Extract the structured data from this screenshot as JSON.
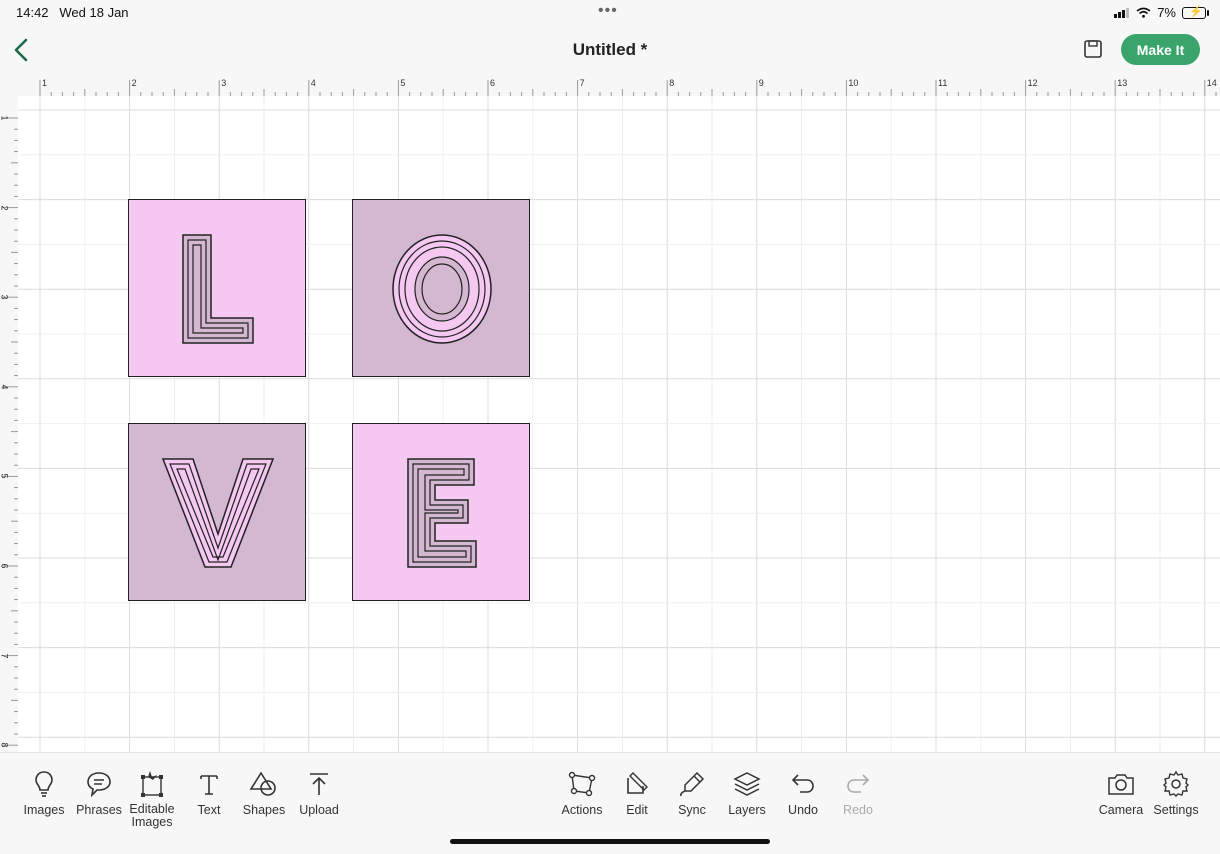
{
  "status": {
    "time": "14:42",
    "date": "Wed 18 Jan",
    "battery": "7%"
  },
  "header": {
    "title": "Untitled *",
    "make_it_label": "Make It"
  },
  "rulers": {
    "top": [
      "1",
      "2",
      "3",
      "4",
      "5",
      "6",
      "7",
      "8",
      "9",
      "10",
      "11",
      "12",
      "13",
      "14"
    ],
    "left": [
      "1",
      "2",
      "3",
      "4",
      "5",
      "6",
      "7",
      "8"
    ]
  },
  "canvas": {
    "tiles": [
      {
        "letter": "L",
        "fill": "#f5c8f1"
      },
      {
        "letter": "O",
        "fill": "#d4b7d0"
      },
      {
        "letter": "V",
        "fill": "#d4b7d0"
      },
      {
        "letter": "E",
        "fill": "#f5c8f1"
      }
    ]
  },
  "toolbar": {
    "left": [
      {
        "label": "Images",
        "icon": "lightbulb-icon"
      },
      {
        "label": "Phrases",
        "icon": "speech-bubble-icon"
      },
      {
        "label": "Editable Images",
        "icon": "editable-images-icon"
      },
      {
        "label": "Text",
        "icon": "text-icon"
      },
      {
        "label": "Shapes",
        "icon": "shapes-icon"
      },
      {
        "label": "Upload",
        "icon": "upload-icon"
      }
    ],
    "center": [
      {
        "label": "Actions",
        "icon": "actions-icon"
      },
      {
        "label": "Edit",
        "icon": "edit-icon"
      },
      {
        "label": "Sync",
        "icon": "sync-icon"
      },
      {
        "label": "Layers",
        "icon": "layers-icon"
      },
      {
        "label": "Undo",
        "icon": "undo-icon"
      },
      {
        "label": "Redo",
        "icon": "redo-icon"
      }
    ],
    "right": [
      {
        "label": "Camera",
        "icon": "camera-icon"
      },
      {
        "label": "Settings",
        "icon": "gear-icon"
      }
    ]
  },
  "colors": {
    "accent": "#3aa46a",
    "tile_light": "#f5c8f1",
    "tile_dark": "#d4b7d0"
  }
}
